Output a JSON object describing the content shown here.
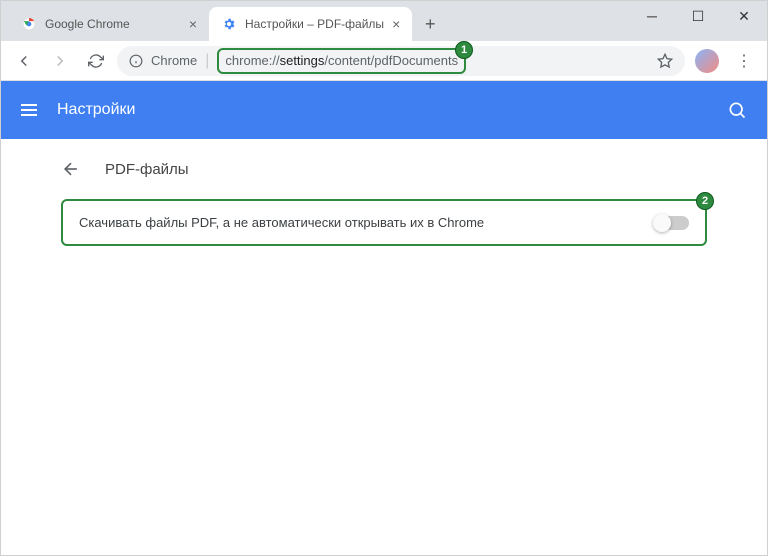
{
  "tabs": {
    "t1": "Google Chrome",
    "t2": "Настройки – PDF-файлы"
  },
  "toolbar": {
    "prefix": "Chrome",
    "url_gray1": "chrome://",
    "url_dark": "settings",
    "url_gray2": "/content/pdfDocuments"
  },
  "header": {
    "title": "Настройки"
  },
  "sub": {
    "title": "PDF-файлы"
  },
  "setting": {
    "label": "Скачивать файлы PDF, а не автоматически открывать их в Chrome"
  },
  "callouts": {
    "one": "1",
    "two": "2"
  }
}
